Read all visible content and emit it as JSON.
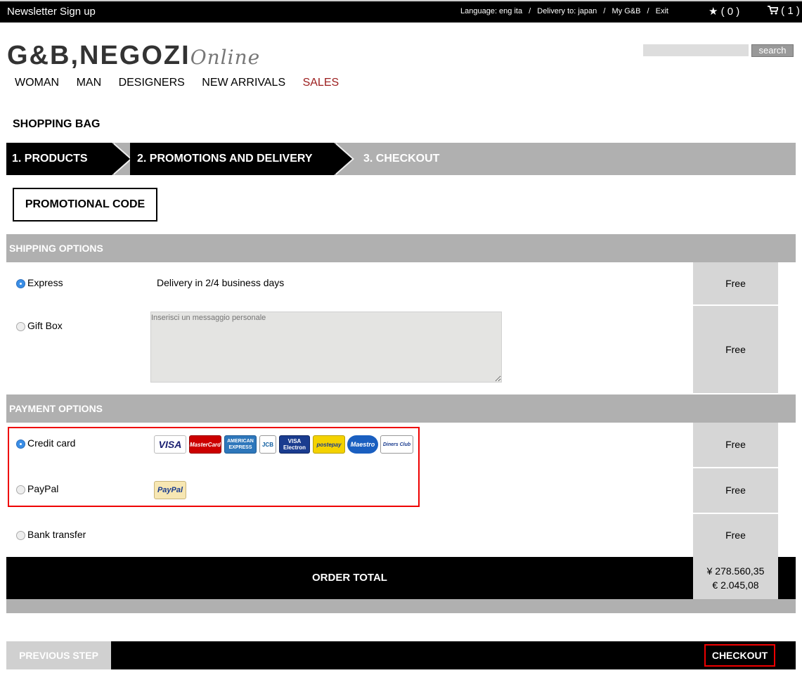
{
  "topbar": {
    "newsletter": "Newsletter Sign up",
    "language": "Language: eng ita",
    "delivery": "Delivery to: japan",
    "my_account": "My G&B",
    "exit": "Exit",
    "sep": "/",
    "favorites_count": "( 0 )",
    "cart_count": "( 1 )"
  },
  "logo": {
    "part1": "G&B,",
    "part2": "NEGOZI",
    "part3": "Online"
  },
  "search": {
    "placeholder": "",
    "button": "search"
  },
  "nav": [
    "WOMAN",
    "MAN",
    "DESIGNERS",
    "NEW ARRIVALS",
    "SALES"
  ],
  "bag_title": "SHOPPING BAG",
  "steps": [
    "1. PRODUCTS",
    "2. PROMOTIONS AND DELIVERY",
    "3. CHECKOUT"
  ],
  "promo_button": "PROMOTIONAL CODE",
  "shipping": {
    "header": "SHIPPING OPTIONS",
    "options": [
      {
        "label": "Express",
        "desc": "Delivery in 2/4 business days",
        "price": "Free"
      },
      {
        "label": "Gift Box",
        "placeholder": "Inserisci un messaggio personale",
        "price": "Free"
      }
    ]
  },
  "payment": {
    "header": "PAYMENT OPTIONS",
    "options": [
      {
        "label": "Credit card",
        "price": "Free"
      },
      {
        "label": "PayPal",
        "price": "Free"
      },
      {
        "label": "Bank transfer",
        "price": "Free"
      }
    ],
    "cards": [
      "VISA",
      "MasterCard",
      "AMERICAN EXPRESS",
      "JCB",
      "VISA Electron",
      "postepay",
      "Maestro",
      "Diners Club"
    ],
    "paypal_logo": "PayPal"
  },
  "order_total": {
    "label": "ORDER TOTAL",
    "yen": "¥ 278.560,35",
    "eur": "€ 2.045,08"
  },
  "footer": {
    "previous": "PREVIOUS STEP",
    "checkout": "CHECKOUT"
  },
  "colors": {
    "sales": "#9b1c1c",
    "highlight": "#ee0000",
    "radio_selected": "#3a8ee6",
    "section_gray": "#b0b0b0"
  }
}
